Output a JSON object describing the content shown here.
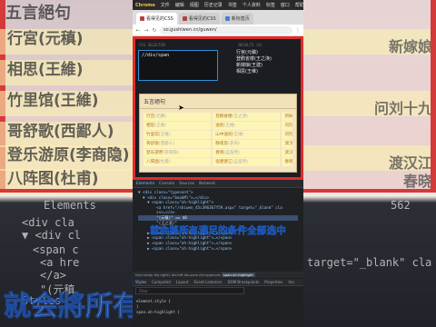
{
  "background": {
    "left_heading": "五言絕句",
    "left_items": [
      "行宮(元稹)",
      "相思(王維)",
      "竹里馆(王維)",
      "哥舒歌(西鄙人)",
      "登乐游原(李商隐)",
      "八阵图(杜甫)"
    ],
    "left_code_lines": [
      "Elements",
      "<div cla",
      "▼ <div cl",
      "<span c",
      "<a hre",
      "</a>",
      "\"(元稹",
      "</span>",
      "Styles"
    ],
    "right_items": [
      "新嫁娘",
      "问刘十九",
      "渡汉江",
      "春晓"
    ],
    "right_code_lines": [
      "562",
      "target=\"_blank\" cla"
    ],
    "bottom_left_caption": "就会將所有满足的条件全部选中",
    "colors": {
      "highlight": "#faf1b1",
      "red": "#e02b2b"
    }
  },
  "browser": {
    "mac_menu": [
      "Chrome",
      "文件",
      "编辑",
      "视图",
      "历史记录",
      "书签",
      "个人资料",
      "标签",
      "窗口",
      "帮助"
    ],
    "tabs": [
      {
        "label": "看得见的CSS",
        "active": true
      },
      {
        "label": "看得见的CSS",
        "active": false
      },
      {
        "label": "新标签页",
        "active": false
      }
    ],
    "url": "so.gushiwen.cn/guwen/",
    "nav_icons": [
      "back-arrow-icon",
      "forward-arrow-icon",
      "reload-icon"
    ]
  },
  "playground": {
    "label_selector": "CSS SELECTOR",
    "label_results": "RESULTS (6)",
    "selector_value": "//div/span",
    "results": [
      "行宫(元稹)",
      "登鹳雀楼(王之涣)",
      "新嫁娘(王建)",
      "相思(王维)"
    ],
    "html_panel_title": "五言絕句",
    "grid_rows": [
      [
        {
          "title": "行宫",
          "author": "(元稹)"
        },
        {
          "title": "登鹳雀楼",
          "author": "(王之涣)"
        },
        {
          "title": "新嫁",
          "author": ""
        }
      ],
      [
        {
          "title": "相思",
          "author": "(王维)"
        },
        {
          "title": "送别",
          "author": "(王维)"
        },
        {
          "title": "问刘",
          "author": ""
        }
      ],
      [
        {
          "title": "竹里馆",
          "author": "(王维)"
        },
        {
          "title": "山中送别",
          "author": "(王维)"
        },
        {
          "title": "问刘",
          "author": ""
        }
      ],
      [
        {
          "title": "哥舒歌",
          "author": "(西鄙人)"
        },
        {
          "title": "静夜思",
          "author": "(李白)"
        },
        {
          "title": "渡汉",
          "author": ""
        }
      ],
      [
        {
          "title": "登乐游原",
          "author": "(李商隐)"
        },
        {
          "title": "春晓",
          "author": "(孟浩然)"
        },
        {
          "title": "渡汉",
          "author": ""
        }
      ],
      [
        {
          "title": "八阵图",
          "author": "(杜甫)"
        },
        {
          "title": "宿建德江",
          "author": "(孟浩然)"
        },
        {
          "title": "春晓",
          "author": ""
        }
      ]
    ]
  },
  "devtools": {
    "tabs": [
      "Elements",
      "Console",
      "Sources",
      "Network"
    ],
    "code_lines": [
      "▼ <div class=\"typecont\">",
      "  ▼ <div class=\"bookMl\">…</div>",
      "    ▼ <span class=\"xh-highlight\">",
      "        <a href=\"/shiwen_45c396367f59.aspx\" target=\"_blank\" cla",
      "        ss>…</a>",
      "        \"(元稹)\" == $0",
      "        \"(王之涣)\"",
      "      </span>",
      "    ▶ <span class=\"xh-highlight\">…</span>",
      "    ▶ <span class=\"xh-highlight\">…</span>",
      "    ▶ <span class=\"xh-highlight\">…</span>",
      "    ▶ <span class=\"xh-highlight\">…</span>"
    ],
    "caption": "就会將所有满足的条件全部选中",
    "breadcrumbs": [
      "html",
      "body",
      "div.right1",
      "div.left",
      "div.sons",
      "div.typecont",
      "span.xh-highlight"
    ],
    "subtabs": [
      "Styles",
      "Computed",
      "Layout",
      "Event Listeners",
      "DOM Breakpoints",
      "Properties",
      "Acc"
    ],
    "filter_placeholder": "Filter",
    "style_lines": [
      "element.style {",
      "}",
      "span.xh-highlight {"
    ]
  }
}
